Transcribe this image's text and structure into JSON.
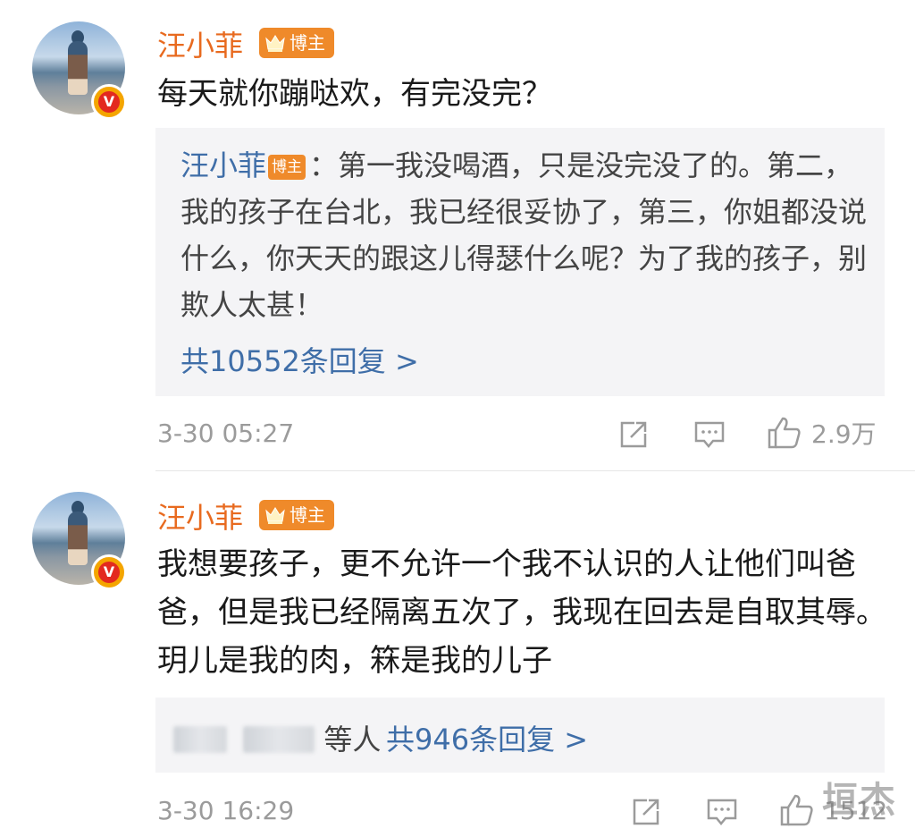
{
  "comments": [
    {
      "user": "汪小菲",
      "badge": "博主",
      "text": "每天就你蹦哒欢，有完没完？",
      "reply": {
        "user": "汪小菲",
        "badge": "博主",
        "text": "：第一我没喝酒，只是没完没了的。第二，我的孩子在台北，我已经很妥协了，第三，你姐都没说什么，你天天的跟这儿得瑟什么呢？为了我的孩子，别欺人太甚！",
        "count_label": "共10552条回复 >"
      },
      "time": "3-30 05:27",
      "likes": "2.9万"
    },
    {
      "user": "汪小菲",
      "badge": "博主",
      "text": "我想要孩子，更不允许一个我不认识的人让他们叫爸爸，但是我已经隔离五次了，我现在回去是自取其辱。玥儿是我的肉，箖是我的儿子",
      "reply": {
        "names_suffix": "等人",
        "count_label": "共946条回复 >"
      },
      "time": "3-30 16:29",
      "likes": "1512"
    }
  ],
  "watermark": "垣杰",
  "colors": {
    "username": "#e86a1f",
    "link_blue": "#3f6ea8",
    "badge_orange": "#ef8a2a",
    "verified_red": "#e3291f",
    "meta_gray": "#9b9b9b",
    "reply_bg": "#f4f4f6"
  }
}
